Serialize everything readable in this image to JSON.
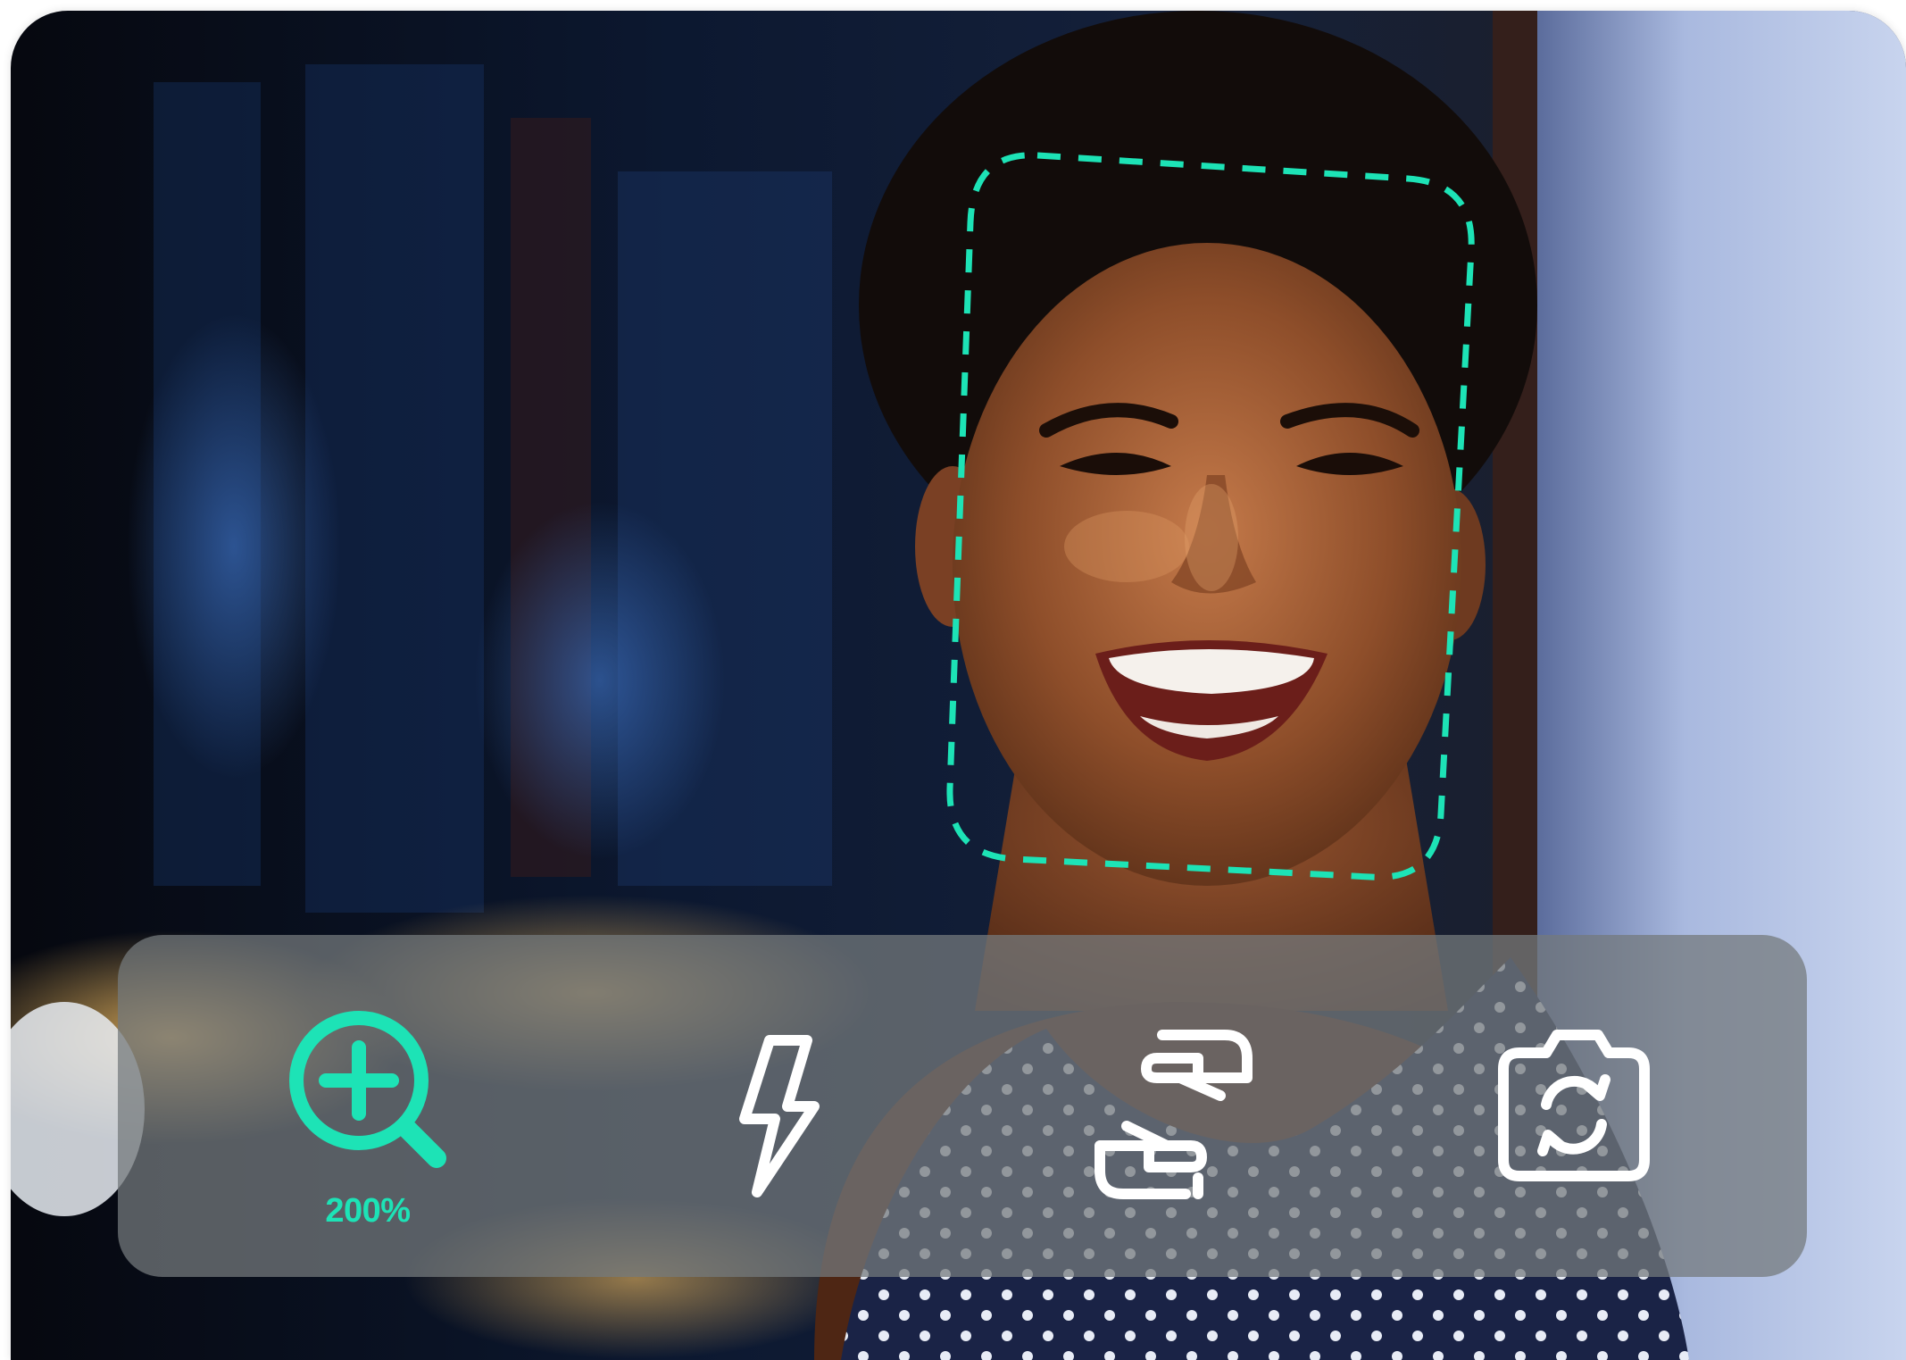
{
  "theme": {
    "accent": "#1de3b6",
    "icon_color": "#ffffff",
    "toolbar_bg": "rgba(116,122,124,0.74)"
  },
  "toolbar": {
    "items": [
      {
        "icon": "zoom-in-icon",
        "label": "200%",
        "active": true
      },
      {
        "icon": "flash-icon",
        "label": ""
      },
      {
        "icon": "hands-icon",
        "label": ""
      },
      {
        "icon": "camera-switch-icon",
        "label": ""
      }
    ]
  }
}
